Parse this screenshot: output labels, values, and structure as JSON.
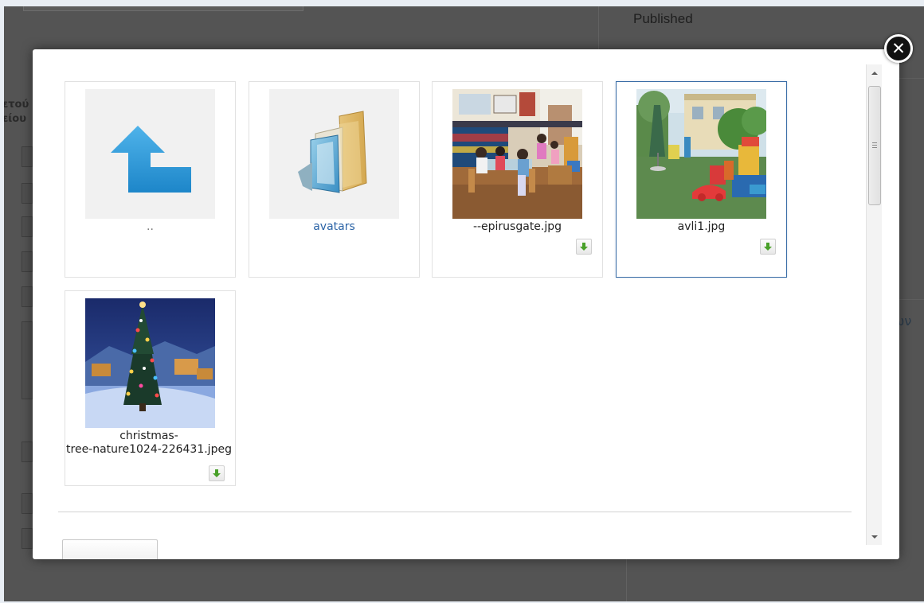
{
  "background": {
    "published_label": "Published",
    "left_fragment_1": "ετού",
    "left_fragment_2": "είου",
    "right_fragment": "ων"
  },
  "modal": {
    "close_glyph": "✕",
    "items": [
      {
        "label": "..",
        "type": "parent-folder",
        "icon": "up-arrow-icon"
      },
      {
        "label": "avatars",
        "type": "folder",
        "icon": "folder-icon"
      },
      {
        "label": "--epirusgate.jpg",
        "type": "image",
        "icon": "download-icon"
      },
      {
        "label": "avli1.jpg",
        "type": "image",
        "selected": true,
        "icon": "download-icon"
      },
      {
        "label_line1": "christmas-",
        "label_line2": "tree-nature1024-226431.jpeg",
        "type": "image",
        "icon": "download-icon"
      }
    ]
  },
  "colors": {
    "accent": "#3b6ea7",
    "folder_text": "#2b63a6",
    "up_arrow": "#2a9ad8",
    "download_arrow": "#48a028",
    "overlay": "#545454"
  }
}
